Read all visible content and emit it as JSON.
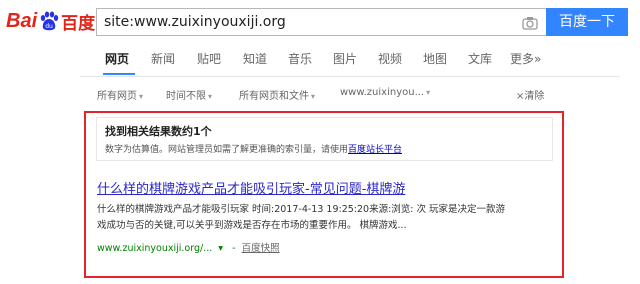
{
  "logo": {
    "text_latin": "Bai",
    "text_cn": "百度",
    "paw_text": "du"
  },
  "search": {
    "query": "site:www.zuixinyouxiji.org",
    "button_label": "百度一下"
  },
  "tabs": [
    {
      "label": "网页",
      "active": true
    },
    {
      "label": "新闻"
    },
    {
      "label": "贴吧"
    },
    {
      "label": "知道"
    },
    {
      "label": "音乐"
    },
    {
      "label": "图片"
    },
    {
      "label": "视频"
    },
    {
      "label": "地图"
    },
    {
      "label": "文库"
    },
    {
      "label": "更多»"
    }
  ],
  "filters": {
    "all_pages": "所有网页",
    "time": "时间不限",
    "all_files": "所有网页和文件",
    "site": "www.zuixinyou...",
    "clear": "×清除"
  },
  "notice": {
    "title": "找到相关结果数约1个",
    "body": "数字为估算值。网站管理员如需了解更准确的索引量，请使用",
    "link": "百度站长平台"
  },
  "result": {
    "title": "什么样的棋牌游戏产品才能吸引玩家-常见问题-棋牌游",
    "snippet_line1": "什么样的棋牌游戏产品才能吸引玩家 时间:2017-4-13 19:25:20来源:浏览: 次 玩家是决定一款游",
    "snippet_line2": "戏成功与否的关键,可以关乎到游戏是否存在市场的重要作用。 棋牌游戏...",
    "url": "www.zuixinyouxiji.org/...",
    "arrow": "▾",
    "sep": "-",
    "cache": "百度快照"
  },
  "colors": {
    "brand_red": "#e1251b",
    "button_blue": "#3385ff",
    "link_blue": "#2b27c9",
    "url_green": "#008000",
    "highlight_red": "#e0262c"
  }
}
